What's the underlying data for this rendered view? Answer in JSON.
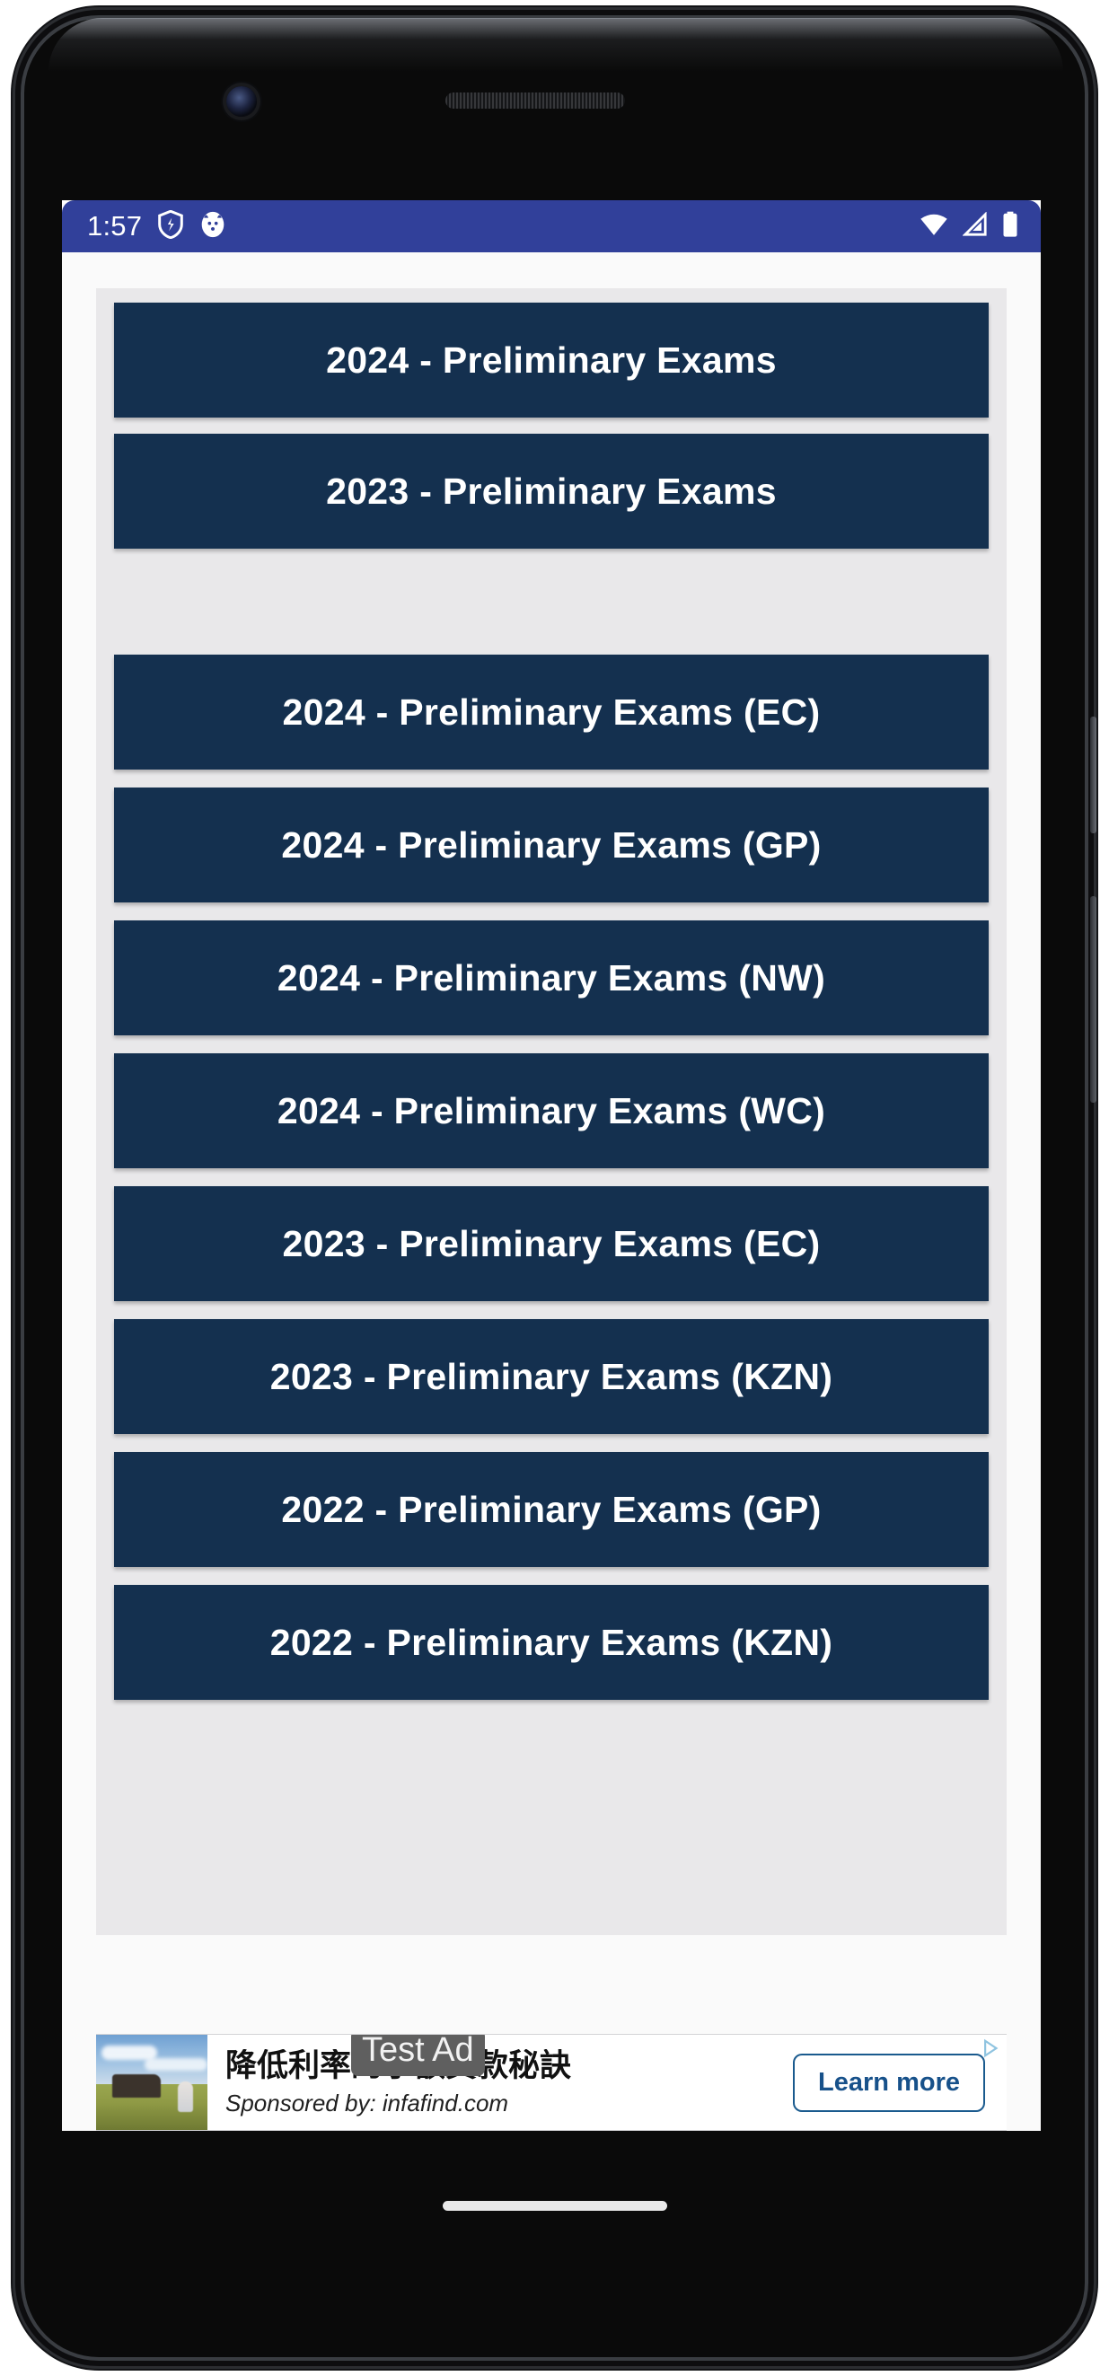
{
  "device": {
    "frame": "android-phone-mockup",
    "bezel_color": "#0a0a0a",
    "camera": "front-camera",
    "speaker": "earpiece-speaker",
    "home_indicator": "gesture-pill"
  },
  "status_bar": {
    "time": "1:57",
    "background_color": "#31409A",
    "left_icons": [
      "shield-icon",
      "app-notification-icon"
    ],
    "right_icons": [
      "wifi-icon",
      "cell-signal-icon",
      "battery-icon"
    ]
  },
  "theme": {
    "page_background": "#FAFAFA",
    "card_background": "#E9E8EA",
    "button_background": "#14304F",
    "button_text_color": "#FFFFFF"
  },
  "main": {
    "groups": [
      {
        "name": "national-preliminary-exams",
        "buttons": [
          {
            "label": "2024 - Preliminary Exams"
          },
          {
            "label": "2023 - Preliminary Exams"
          }
        ]
      },
      {
        "name": "provincial-preliminary-exams",
        "buttons": [
          {
            "label": "2024 - Preliminary Exams (EC)"
          },
          {
            "label": "2024 - Preliminary Exams (GP)"
          },
          {
            "label": "2024 - Preliminary Exams (NW)"
          },
          {
            "label": "2024 - Preliminary Exams (WC)"
          },
          {
            "label": "2023 - Preliminary Exams (EC)"
          },
          {
            "label": "2023 - Preliminary Exams (KZN)"
          },
          {
            "label": "2022 - Preliminary Exams (GP)"
          },
          {
            "label": "2022 - Preliminary Exams (KZN)"
          }
        ]
      }
    ]
  },
  "ad": {
    "overlay_label": "Test Ad",
    "headline": "降低利率的小額貸款秘訣",
    "sponsor": "Sponsored by: infafind.com",
    "cta_label": "Learn more",
    "thumbnail": "landscape-photo",
    "adchoices": "adchoices-icon"
  }
}
